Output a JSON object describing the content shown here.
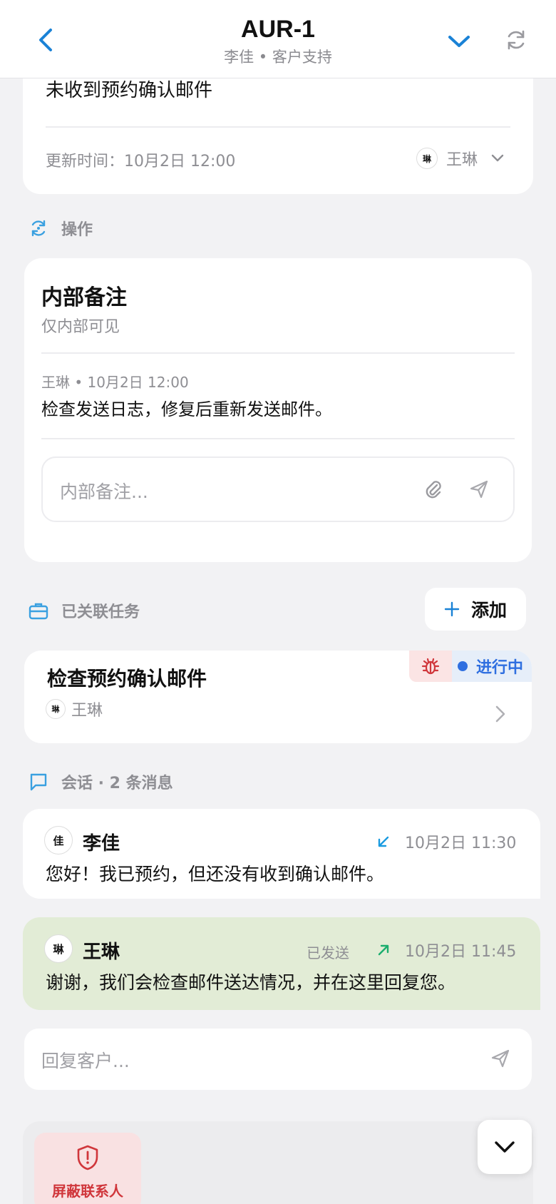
{
  "header": {
    "title": "AUR-1",
    "subtitle": "李佳 • 客户支持"
  },
  "top_card": {
    "subject": "未收到预约确认邮件",
    "updated": "更新时间：10月2日 12:00",
    "assignee": "王琳"
  },
  "actions_section": {
    "label": "操作"
  },
  "internal_note": {
    "title": "内部备注",
    "subtitle": "仅内部可见",
    "note_meta": "王琳 • 10月2日 12:00",
    "note_text": "检查发送日志，修复后重新发送邮件。",
    "input_placeholder": "内部备注..."
  },
  "linked_tasks": {
    "label": "已关联任务",
    "add_label": "添加",
    "task": {
      "title": "检查预约确认邮件",
      "assignee": "王琳",
      "status": "进行中"
    }
  },
  "conversation": {
    "label": "会话 · 2 条消息",
    "messages": [
      {
        "sender": "李佳",
        "time": "10月2日 11:30",
        "text": "您好！我已预约，但还没有收到确认邮件。",
        "direction": "incoming"
      },
      {
        "sender": "王琳",
        "status": "已发送",
        "time": "10月2日 11:45",
        "text": "谢谢，我们会检查邮件送达情况，并在这里回复您。",
        "direction": "outgoing"
      }
    ],
    "reply_placeholder": "回复客户..."
  },
  "bottom_actions": {
    "block_label": "屏蔽联系人"
  },
  "colors": {
    "accent": "#1a82d6",
    "status_blue": "#2f6fe0",
    "bug_red": "#d0363b",
    "outgoing_bg": "#e2ecd6",
    "danger_bg": "#f9e1e2",
    "danger_text": "#d0363b"
  }
}
